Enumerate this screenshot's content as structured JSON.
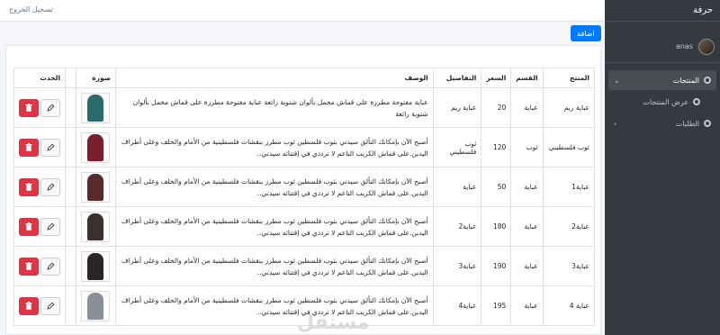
{
  "brand": "حرفة",
  "user": {
    "name": "anas"
  },
  "sidebar": {
    "items": [
      {
        "label": "المنتجات",
        "active": true
      },
      {
        "label": "عرض المنتجات",
        "active": false
      },
      {
        "label": "الطلبات",
        "active": false
      }
    ]
  },
  "topbar": {
    "logout_label": "تسجيل الخروج"
  },
  "toolbar": {
    "add_label": "اضافة"
  },
  "table": {
    "headers": [
      "المنتج",
      "القسم",
      "السعر",
      "التفاصيل",
      "الوصف",
      "صورة",
      "الحدث"
    ],
    "rows": [
      {
        "product": "عباية ريم",
        "section": "عباية",
        "price": "20",
        "details": "عباية ريم",
        "description": "عباية مفتوحة مطرزة على قماش مخمل بألوان شتوية رائعة عباية مفتوحة مطرزة على قماش مخمل بألوان شتوية رائعة",
        "color": "#2c6b6b"
      },
      {
        "product": "ثوب فلسطيني",
        "section": "ثوب",
        "price": "120",
        "details": "ثوب فلسطيني",
        "description": "أصبح الآن بإمكانك التألق سيدتي بثوب فلسطين ثوب مطرز بنقشات فلسطينية من الأمام والخلف وعلى أطراف اليدين.على قماش الكريب الناعم لا ترددي في إقتنائه سيدتي..",
        "color": "#7a1f2b"
      },
      {
        "product": "عباية1",
        "section": "عباية",
        "price": "50",
        "details": "عباية",
        "description": "أصبح الآن بإمكانك التألق سيدتي بثوب فلسطين ثوب مطرز بنقشات فلسطينية من الأمام والخلف وعلى أطراف اليدين.على قماش الكريب الناعم لا ترددي في إقتنائه سيدتي..",
        "color": "#5a2a2a"
      },
      {
        "product": "عباية2",
        "section": "عباية",
        "price": "180",
        "details": "عباية2",
        "description": "أصبح الآن بإمكانك التألق سيدتي بثوب فلسطين ثوب مطرز بنقشات فلسطينية من الأمام والخلف وعلى أطراف اليدين.على قماش الكريب الناعم لا ترددي في إقتنائه سيدتي..",
        "color": "#3a3030"
      },
      {
        "product": "عباية3",
        "section": "عباية",
        "price": "190",
        "details": "عباية3",
        "description": "أصبح الآن بإمكانك التألق سيدتي بثوب فلسطين ثوب مطرز بنقشات فلسطينية من الأمام والخلف وعلى أطراف اليدين.على قماش الكريب الناعم لا ترددي في إقتنائه سيدتي..",
        "color": "#2a2626"
      },
      {
        "product": "عباية 4",
        "section": "عباية",
        "price": "195",
        "details": "عباية4",
        "description": "أصبح الآن بإمكانك التألق سيدتي بثوب فلسطين ثوب مطرز بنقشات فلسطينية من الأمام والخلف وعلى أطراف اليدين.على قماش الكريب الناعم لا ترددي في إقتنائه سيدتي..",
        "color": "#8a8f98"
      }
    ]
  },
  "watermark": "مستقل",
  "colors": {
    "sidebar_bg": "#343a40",
    "primary": "#007bff",
    "danger": "#dc3545"
  }
}
